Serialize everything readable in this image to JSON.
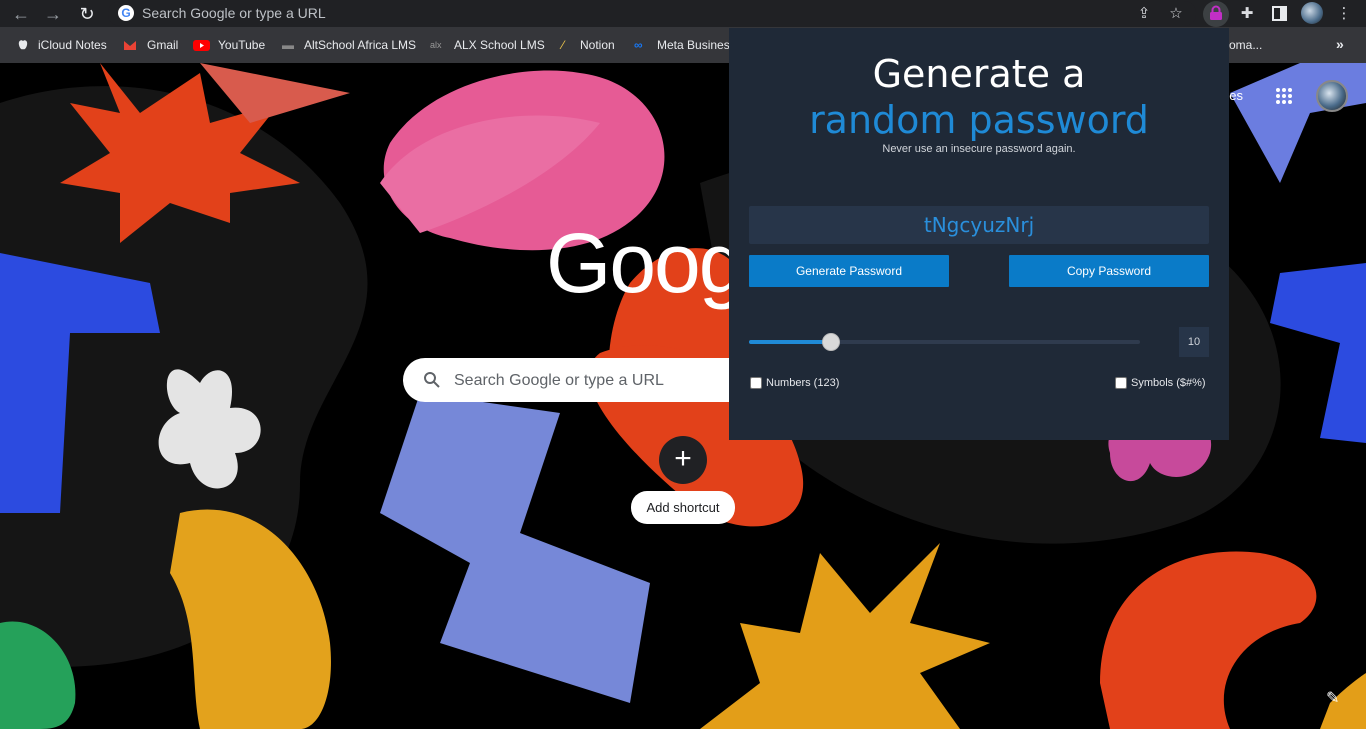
{
  "browser": {
    "omnibox_placeholder": "Search Google or type a URL",
    "bookmarks": [
      {
        "label": "iCloud Notes"
      },
      {
        "label": "Gmail"
      },
      {
        "label": "YouTube"
      },
      {
        "label": "AltSchool Africa LMS"
      },
      {
        "label": "ALX School LMS"
      },
      {
        "label": "Notion"
      },
      {
        "label": "Meta Business"
      },
      {
        "label": "oma..."
      }
    ],
    "more_bookmarks": "»"
  },
  "ntp": {
    "logo_text": "Goog",
    "search_placeholder": "Search Google or type a URL",
    "add_shortcut_label": "Add shortcut",
    "images_link": "ges"
  },
  "popup": {
    "title_line1": "Generate a",
    "title_line2": "random password",
    "subtitle": "Never use an insecure password again.",
    "password": "tNgcyuzNrj",
    "generate_label": "Generate Password",
    "copy_label": "Copy Password",
    "length": 10,
    "length_display": "10",
    "length_fraction": 0.21,
    "numbers_label": "Numbers (123)",
    "symbols_label": "Symbols ($#%)",
    "numbers_checked": false,
    "symbols_checked": false,
    "accent_color": "#1f8ad6",
    "button_color": "#0a7bc8",
    "background_color": "#1f2937"
  }
}
